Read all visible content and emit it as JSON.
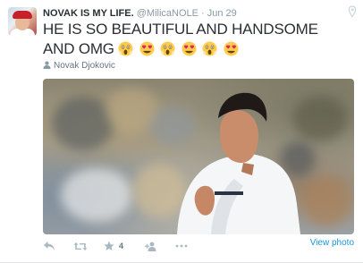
{
  "tweet": {
    "fullname": "NOVAK IS MY LIFE.",
    "username": "@MilicaNOLE",
    "separator": "·",
    "time": "Jun 29",
    "text": "HE IS SO BEAUTIFUL AND HANDSOME AND OMG",
    "emojis": [
      "scream-emoji",
      "heart-eyes-emoji",
      "scream-emoji",
      "heart-eyes-emoji",
      "scream-emoji",
      "heart-eyes-emoji"
    ],
    "tagged_person": "Novak Djokovic",
    "view_photo_label": "View photo",
    "favorite_count": "4"
  },
  "colors": {
    "text": "#292f33",
    "muted": "#8899a6",
    "link": "#1b95e0",
    "emoji_yellow": "#ffcc4d",
    "heart_red": "#e0245e"
  },
  "icons": [
    "pin-icon",
    "person-icon",
    "reply-icon",
    "retweet-icon",
    "star-icon",
    "follow-icon",
    "more-icon"
  ]
}
